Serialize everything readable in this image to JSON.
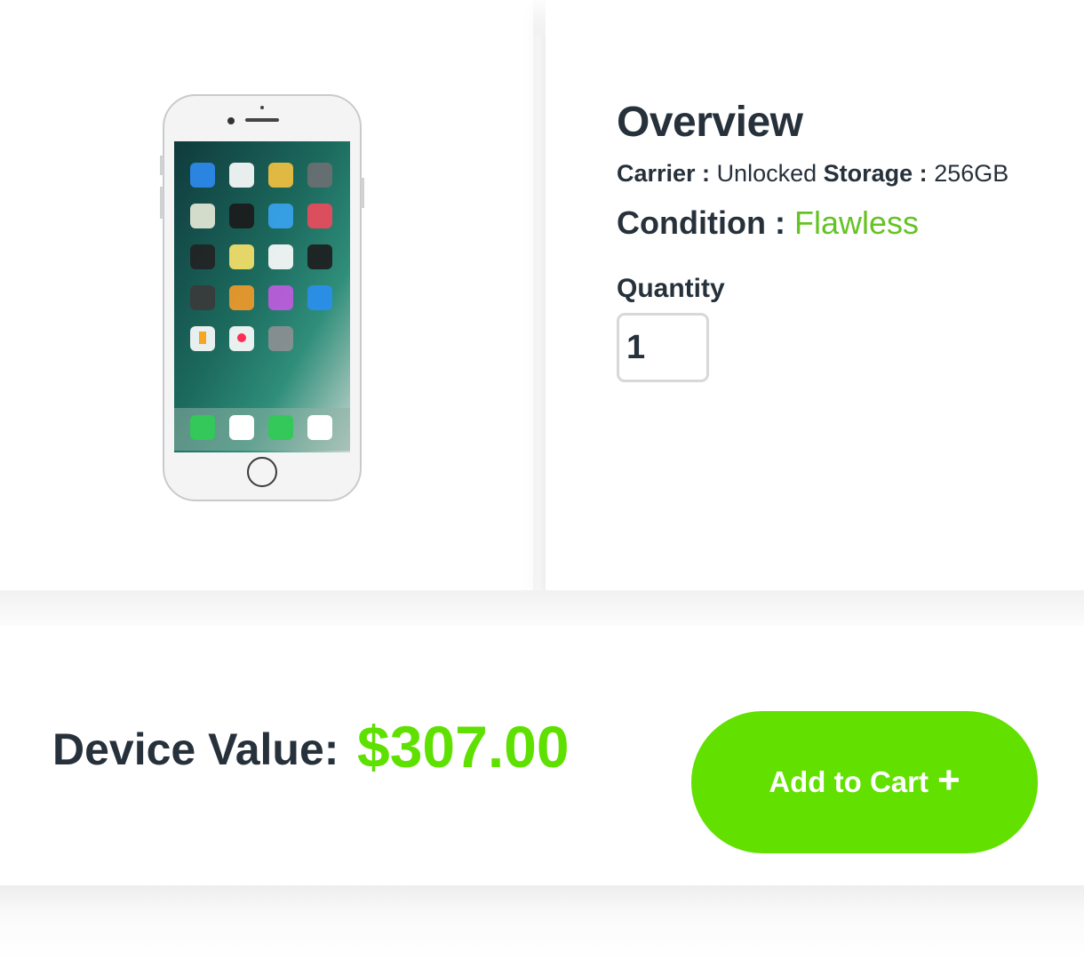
{
  "overview": {
    "title": "Overview",
    "carrier_label": "Carrier :",
    "carrier_value": "Unlocked",
    "storage_label": "Storage :",
    "storage_value": "256GB",
    "condition_label": "Condition :",
    "condition_value": "Flawless",
    "quantity_label": "Quantity",
    "quantity_value": "1"
  },
  "bottom": {
    "device_value_label": "Device Value:",
    "price": "$307.00",
    "add_to_cart_label": "Add to Cart",
    "add_to_cart_icon": "plus-icon"
  },
  "colors": {
    "accent_green": "#62e000",
    "condition_green": "#64c323",
    "text_dark": "#27313b"
  }
}
